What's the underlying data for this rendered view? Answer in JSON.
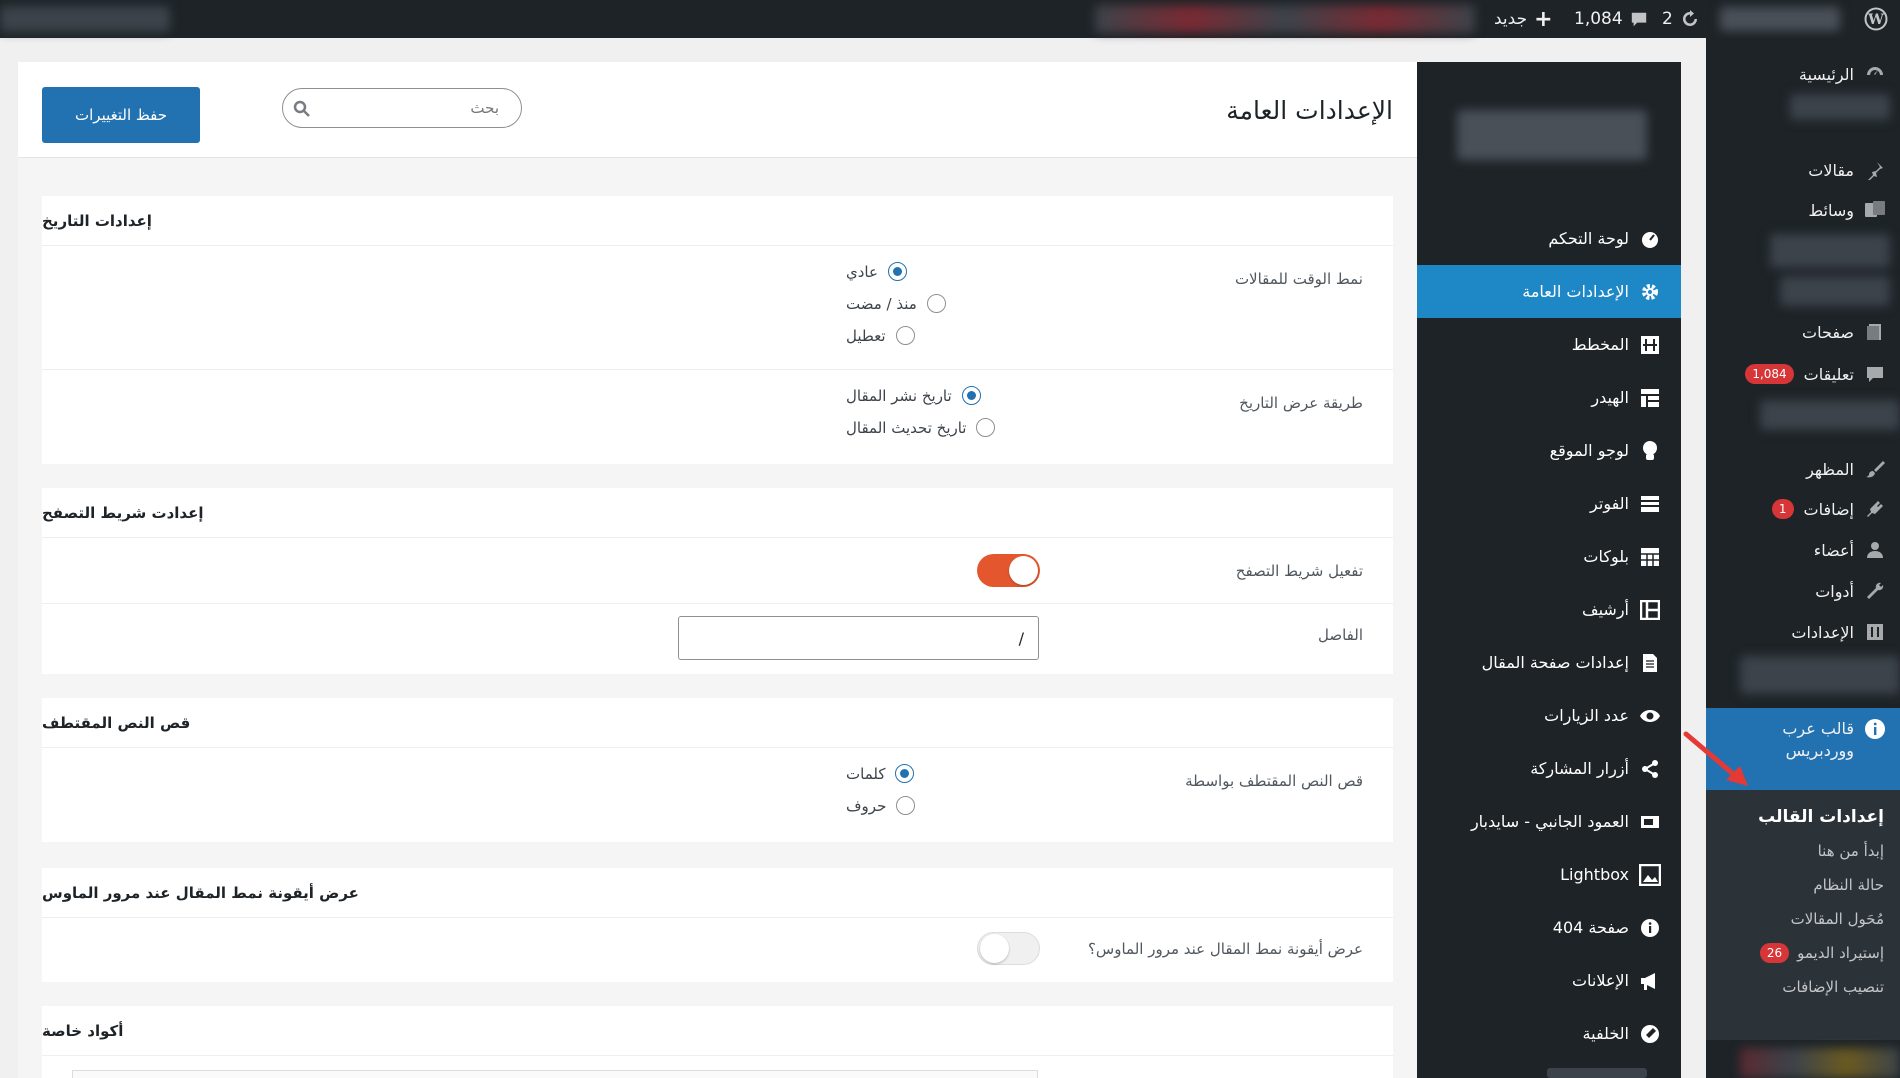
{
  "adminbar": {
    "updates_count": "2",
    "comments_count": "1,084",
    "new_label": "جديد"
  },
  "wpmenu": {
    "dashboard": "الرئيسية",
    "posts": "مقالات",
    "media": "وسائط",
    "pages": "صفحات",
    "comments": "تعليقات",
    "comments_badge": "1,084",
    "appearance": "المظهر",
    "plugins": "إضافات",
    "plugins_badge": "1",
    "users": "أعضاء",
    "tools": "أدوات",
    "settings": "الإعدادات",
    "theme_menu_line1": "قالب عرب",
    "theme_menu_line2": "ووردبريس",
    "submenu": {
      "theme_settings": "إعدادات القالب",
      "start_here": "إبدأ من هنا",
      "system_status": "حالة النظام",
      "posts_converter": "مُحَول المقالات",
      "demo_import": "إستيراد الديمو",
      "demo_badge": "26",
      "install_plugins": "تنصيب الإضافات"
    }
  },
  "theme_sidebar": {
    "items": [
      {
        "label": "لوحة التحكم",
        "icon": "dashboard-icon"
      },
      {
        "label": "الإعدادات العامة",
        "icon": "gear-icon"
      },
      {
        "label": "المخطط",
        "icon": "layout-icon"
      },
      {
        "label": "الهيدر",
        "icon": "header-icon"
      },
      {
        "label": "لوجو الموقع",
        "icon": "lightbulb-icon"
      },
      {
        "label": "الفوتر",
        "icon": "footer-icon"
      },
      {
        "label": "بلوكات",
        "icon": "blocks-icon"
      },
      {
        "label": "أرشيف",
        "icon": "archive-icon"
      },
      {
        "label": "إعدادات صفحة المقال",
        "icon": "document-icon"
      },
      {
        "label": "عدد الزيارات",
        "icon": "eye-icon"
      },
      {
        "label": "أزرار المشاركة",
        "icon": "share-icon"
      },
      {
        "label": "العمود الجانبي - سايدبار",
        "icon": "sidebar-icon"
      },
      {
        "label": "Lightbox",
        "icon": "image-icon"
      },
      {
        "label": "صفحة 404",
        "icon": "info-icon"
      },
      {
        "label": "الإعلانات",
        "icon": "megaphone-icon"
      },
      {
        "label": "الخلفية",
        "icon": "palette-icon"
      }
    ]
  },
  "header": {
    "title": "الإعدادات العامة",
    "search_placeholder": "بحث",
    "save_label": "حفظ التغييرات"
  },
  "sections": {
    "date": {
      "title": "إعدادات التاريخ",
      "time_format_label": "نمط الوقت للمقالات",
      "time_options": [
        "عادي",
        "منذ / مضت",
        "تعطيل"
      ],
      "display_label": "طريقة عرض التاريخ",
      "display_options": [
        "تاريخ نشر المقال",
        "تاريخ تحديث المقال"
      ]
    },
    "breadcrumb": {
      "title": "إعدادت شريط التصفح",
      "enable_label": "تفعيل شريط التصفح",
      "enabled": true,
      "separator_label": "الفاصل",
      "separator_value": "/"
    },
    "excerpt": {
      "title": "قص النص المقتطف",
      "by_label": "قص النص المقتطف بواسطة",
      "options": [
        "كلمات",
        "حروف"
      ]
    },
    "hover_icon": {
      "title": "عرض أيقونة نمط المقال عند مرور الماوس",
      "label": "عرض أيقونة نمط المقال عند مرور الماوس؟",
      "enabled": false
    },
    "custom_codes": {
      "title": "أكواد خاصة"
    }
  },
  "colors": {
    "accent": "#2271b1",
    "toggle_on": "#e4572e",
    "toggle_off": "#f0f0f1"
  }
}
